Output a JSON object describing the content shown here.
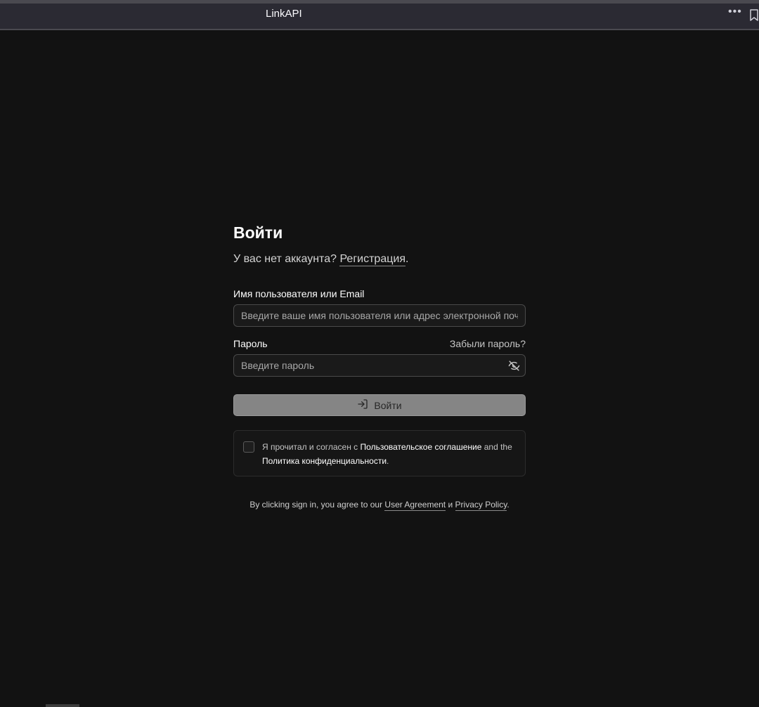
{
  "browser": {
    "title": "LinkAPI",
    "more_icon": "more-dots-icon",
    "bookmark_icon": "bookmark-icon"
  },
  "login": {
    "heading": "Войти",
    "no_account": "У вас нет аккаунта?",
    "register_link": "Регистрация",
    "period": ".",
    "username_label": "Имя пользователя или Email",
    "username_placeholder": "Введите ваше имя пользователя или адрес электронной почты",
    "password_label": "Пароль",
    "forgot_link": "Забыли пароль?",
    "password_placeholder": "Введите пароль",
    "submit_label": "Войти",
    "submit_icon": "sign-in-icon",
    "eye_icon": "eye-off-icon"
  },
  "agreement": {
    "prefix": "Я прочитал и согласен с",
    "user_agreement": "Пользовательское соглашение",
    "and_the": "and the",
    "privacy_policy": "Политика конфиденциальности",
    "suffix": "."
  },
  "footer": {
    "prefix": "By clicking sign in, you agree to our",
    "user_agreement": "User Agreement",
    "and": "и",
    "privacy_policy": "Privacy Policy",
    "suffix": "."
  },
  "colors": {
    "background": "#121212",
    "button": "#858585",
    "browser_bar": "#2b2a33"
  }
}
